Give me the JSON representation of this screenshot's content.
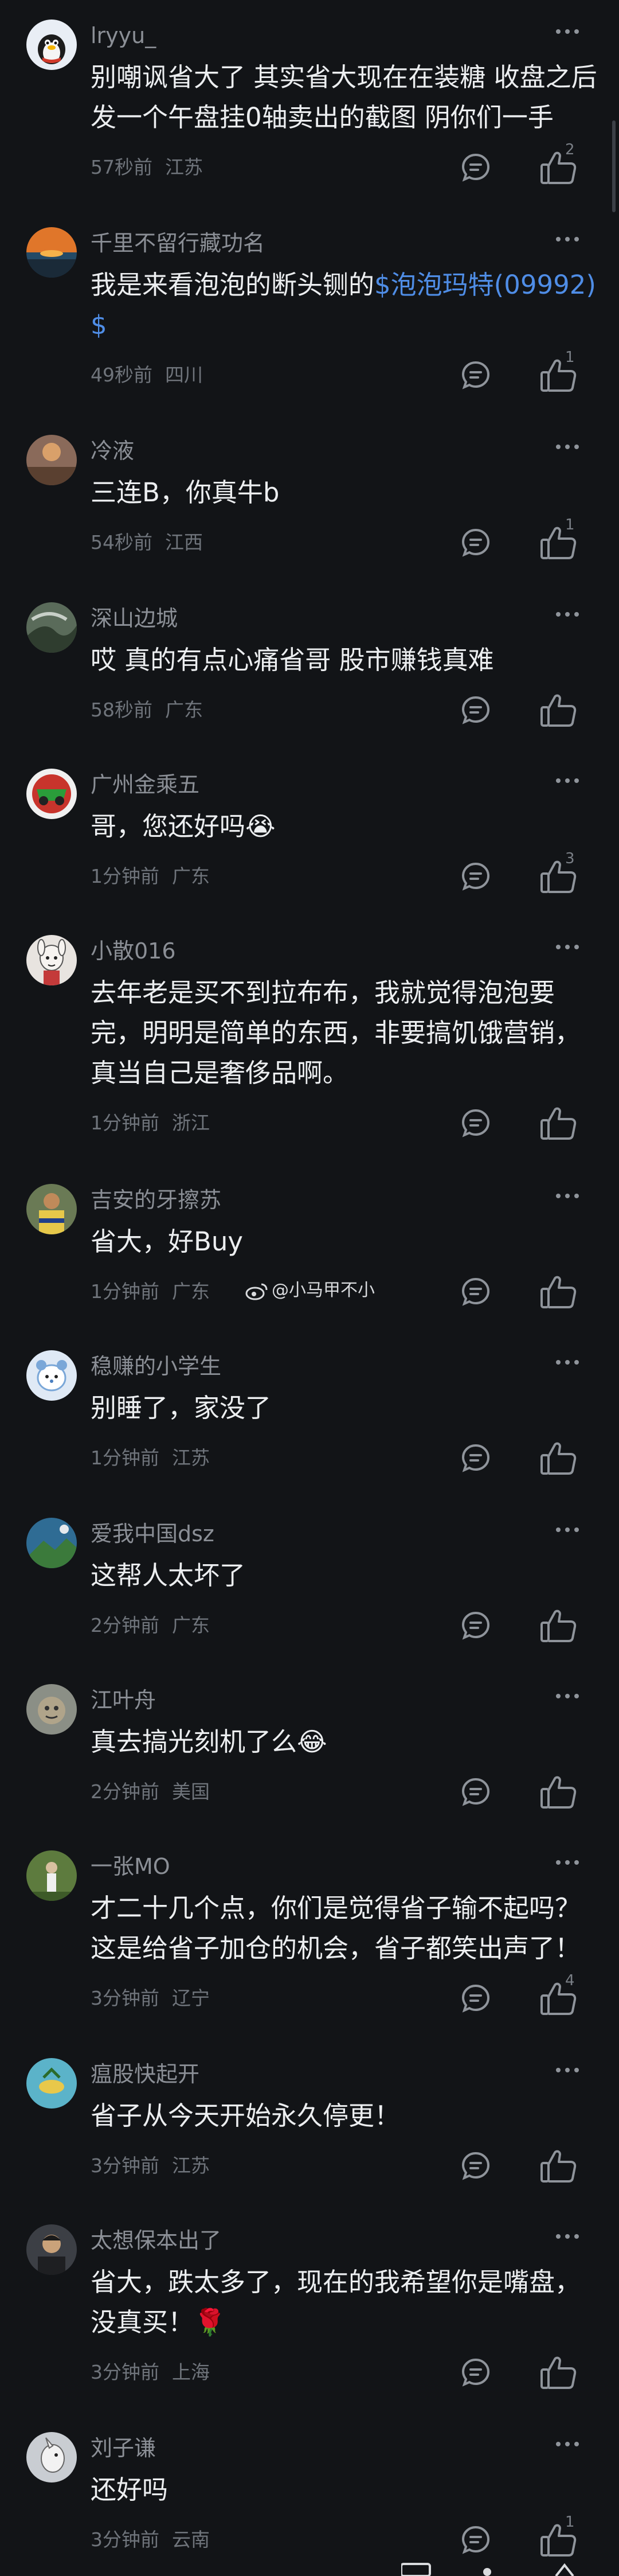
{
  "comments": [
    {
      "username": "lryyu_",
      "text": "别嘲讽省大了 其实省大现在在装糖 收盘之后发一个午盘挂0轴卖出的截图 阴你们一手",
      "time": "57秒前",
      "location": "江苏",
      "likes": "2",
      "avatar_color": "#e9eef5"
    },
    {
      "username": "千里不留行藏功名",
      "text_before": "我是来看泡泡的断头铡的",
      "stock": "$泡泡玛特(09992)$",
      "time": "49秒前",
      "location": "四川",
      "likes": "1",
      "avatar_color": "#e0762a"
    },
    {
      "username": "冷液",
      "text": "三连B，你真牛b",
      "time": "54秒前",
      "location": "江西",
      "likes": "1",
      "avatar_color": "#8a6a5a"
    },
    {
      "username": "深山边城",
      "text": "哎 真的有点心痛省哥 股市赚钱真难",
      "time": "58秒前",
      "location": "广东",
      "likes": "",
      "avatar_color": "#5a6b5a"
    },
    {
      "username": "广州金乘五",
      "text": "哥，您还好吗😭",
      "time": "1分钟前",
      "location": "广东",
      "likes": "3",
      "avatar_color": "#c8342c"
    },
    {
      "username": "小散016",
      "text": "去年老是买不到拉布布，我就觉得泡泡要完，明明是简单的东西，非要搞饥饿营销，真当自己是奢侈品啊。",
      "time": "1分钟前",
      "location": "浙江",
      "likes": "",
      "avatar_color": "#e8e4e0"
    },
    {
      "username": "吉安的牙擦苏",
      "text": "省大，好Buy",
      "time": "1分钟前",
      "location": "广东",
      "likes": "",
      "avatar_color": "#6a7a55"
    },
    {
      "username": "稳赚的小学生",
      "text": "别睡了，家没了",
      "time": "1分钟前",
      "location": "江苏",
      "likes": "",
      "avatar_color": "#dfe9f5"
    },
    {
      "username": "爱我中国dsz",
      "text": "这帮人太坏了",
      "time": "2分钟前",
      "location": "广东",
      "likes": "",
      "avatar_color": "#2f6c94"
    },
    {
      "username": "江叶舟",
      "text": "真去搞光刻机了么😂",
      "time": "2分钟前",
      "location": "美国",
      "likes": "",
      "avatar_color": "#8b8f86"
    },
    {
      "username": "一张MO",
      "text": "才二十几个点，你们是觉得省子输不起吗？这是给省子加仓的机会，省子都笑出声了！",
      "time": "3分钟前",
      "location": "辽宁",
      "likes": "4",
      "avatar_color": "#5d7b3e"
    },
    {
      "username": "瘟股快起开",
      "text": "省子从今天开始永久停更！",
      "time": "3分钟前",
      "location": "江苏",
      "likes": "",
      "avatar_color": "#5bb3c9"
    },
    {
      "username": "太想保本出了",
      "text": "省大，跌太多了，现在的我希望你是嘴盘，没真买！🌹",
      "time": "3分钟前",
      "location": "上海",
      "likes": "",
      "avatar_color": "#3c3f45"
    },
    {
      "username": "刘子谦",
      "text": "还好吗",
      "time": "3分钟前",
      "location": "云南",
      "likes": "1",
      "avatar_color": "#c9cdd2"
    }
  ],
  "watermark": {
    "text": "@小马甲不小"
  },
  "colors": {
    "background": "#121417",
    "username": "#8b8f96",
    "body_text": "#eceef0",
    "meta": "#6f747b",
    "stock_link": "#4f8de6",
    "icon": "#8f949b"
  }
}
